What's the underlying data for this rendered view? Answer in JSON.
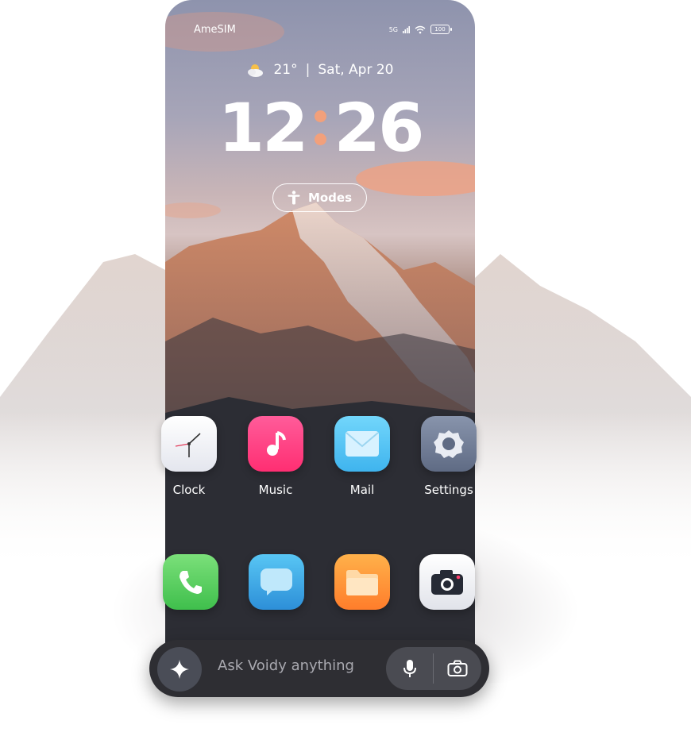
{
  "status": {
    "carrier": "AmeSIM",
    "network": "5G",
    "battery": "100"
  },
  "weather": {
    "temp": "21°",
    "date": "Sat, Apr 20",
    "icon": "partly-cloudy-icon"
  },
  "clock": {
    "hours": "12",
    "minutes": "26"
  },
  "modes": {
    "label": "Modes"
  },
  "apps_row1": [
    {
      "label": "Clock",
      "icon": "clock-icon"
    },
    {
      "label": "Music",
      "icon": "music-note-icon"
    },
    {
      "label": "Mail",
      "icon": "mail-icon"
    },
    {
      "label": "Settings",
      "icon": "gear-icon"
    }
  ],
  "dock": [
    {
      "icon": "phone-icon"
    },
    {
      "icon": "messages-icon"
    },
    {
      "icon": "folder-icon"
    },
    {
      "icon": "camera-icon"
    }
  ],
  "assistant": {
    "placeholder": "Ask Voidy anything"
  },
  "colors": {
    "accent": "#f2a07b",
    "music": "#ff3f86",
    "mail": "#5ac8f5",
    "settings": "#6d7a92"
  }
}
